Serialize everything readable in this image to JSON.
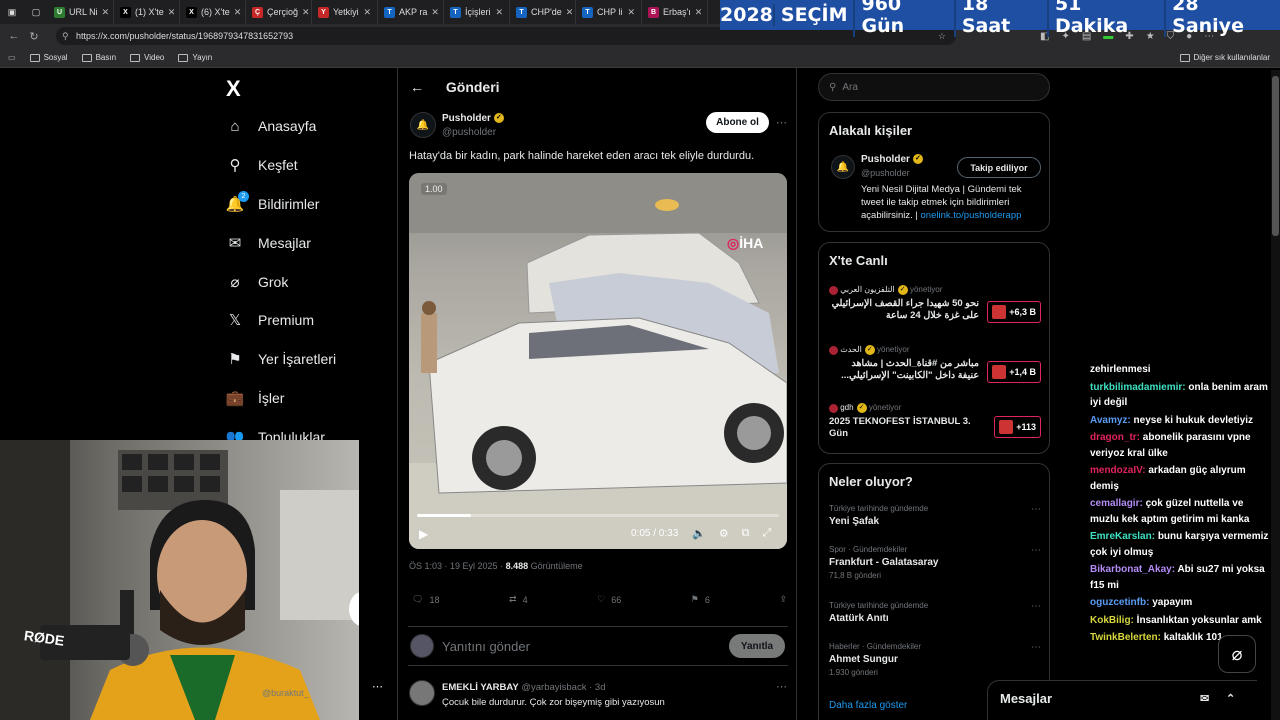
{
  "browser": {
    "tabs": [
      {
        "label": "URL Ni",
        "color": "#2e7d32",
        "glyph": "U"
      },
      {
        "label": "(1) X'te",
        "color": "#000000",
        "glyph": "X"
      },
      {
        "label": "(6) X'te",
        "color": "#000000",
        "glyph": "X"
      },
      {
        "label": "Çerçioğ",
        "color": "#c62828",
        "glyph": "Ç"
      },
      {
        "label": "Yetkiyi",
        "color": "#c62828",
        "glyph": "Y"
      },
      {
        "label": "AKP ra",
        "color": "#1565c0",
        "glyph": "T"
      },
      {
        "label": "İçişleri",
        "color": "#1565c0",
        "glyph": "T"
      },
      {
        "label": "CHP'de",
        "color": "#1565c0",
        "glyph": "T"
      },
      {
        "label": "CHP li",
        "color": "#1565c0",
        "glyph": "T"
      },
      {
        "label": "Erbaş'ı",
        "color": "#ad1457",
        "glyph": "B"
      }
    ],
    "url": "https://x.com/pusholder/status/1968979347831652793",
    "bookmarks": [
      "Sosyal",
      "Basın",
      "Video",
      "Yayın"
    ],
    "other_bookmarks": "Diğer sık kullanılanlar"
  },
  "countdown": {
    "year": "2028",
    "label": "SEÇİM",
    "days": "960 Gün",
    "hours": "18 Saat",
    "minutes": "51 Dakika",
    "seconds": "28 Saniye"
  },
  "nav": {
    "logo": "X",
    "items": [
      {
        "label": "Anasayfa",
        "icon": "home-icon"
      },
      {
        "label": "Keşfet",
        "icon": "search-icon"
      },
      {
        "label": "Bildirimler",
        "icon": "bell-icon",
        "badge": "2"
      },
      {
        "label": "Mesajlar",
        "icon": "mail-icon"
      },
      {
        "label": "Grok",
        "icon": "grok-icon"
      },
      {
        "label": "Premium",
        "icon": "x-icon"
      },
      {
        "label": "Yer İşaretleri",
        "icon": "bookmark-icon"
      },
      {
        "label": "İşler",
        "icon": "briefcase-icon"
      },
      {
        "label": "Topluluklar",
        "icon": "people-icon"
      }
    ],
    "account_handle": "@buraktut_"
  },
  "post": {
    "header": "Gönderi",
    "author_name": "Pusholder",
    "author_handle": "@pusholder",
    "subscribe_label": "Abone ol",
    "text": "Hatay'da bir kadın, park halinde hareket eden aracı tek eliyle durdurdu.",
    "video": {
      "speed": "1.00",
      "watermark": "İHA",
      "time": "0:05 / 0:33",
      "progress": 0.15
    },
    "meta_time": "ÖS 1:03 · 19 Eyl 2025 ·",
    "views": "8.488",
    "views_label": "Görüntüleme",
    "replies": "18",
    "reposts": "4",
    "likes": "66",
    "bookmarks": "6",
    "reply_placeholder": "Yanıtını gönder",
    "reply_button": "Yanıtla"
  },
  "reply_tweet": {
    "name": "EMEKLİ YARBAY",
    "handle": "@yarbayisback",
    "age": "· 3d",
    "text": "Çocuk bile durdurur. Çok zor bişeymiş gibi yazıyosun"
  },
  "sidebar": {
    "search_placeholder": "Ara",
    "related": {
      "title": "Alakalı kişiler",
      "name": "Pusholder",
      "handle": "@pusholder",
      "follow_label": "Takip ediliyor",
      "bio": "Yeni Nesil Dijital Medya | Gündemi tek tweet ile takip etmek için bildirimleri açabilirsiniz. |",
      "link": "onelink.to/pusholderapp"
    },
    "live": {
      "title": "X'te Canlı",
      "items": [
        {
          "host": "التلفزيون العربي",
          "role": "yönetiyor",
          "text": "نحو 50 شهيدا جراء القصف الإسرائيلي على غزة خلال 24 ساعة",
          "count": "+6,3 B"
        },
        {
          "host": "الحدث",
          "role": "yönetiyor",
          "text": "مباشر من #قناة_الحدث | مشاهد عنيفة داخل \"الكابينت\" الإسرائيلي...",
          "count": "+1,4 B"
        },
        {
          "host": "gdh",
          "role": "yönetiyor",
          "text": "2025 TEKNOFEST İSTANBUL 3. Gün",
          "count": "+113"
        }
      ]
    },
    "trends": {
      "title": "Neler oluyor?",
      "items": [
        {
          "category": "Türkiye tarihinde gündemde",
          "name": "Yeni Şafak",
          "count": ""
        },
        {
          "category": "Spor · Gündemdekiler",
          "name": "Frankfurt - Galatasaray",
          "count": "71,8 B gönderi"
        },
        {
          "category": "Türkiye tarihinde gündemde",
          "name": "Atatürk Anıtı",
          "count": ""
        },
        {
          "category": "Haberler · Gündemdekiler",
          "name": "Ahmet Sungur",
          "count": "1.930 gönderi"
        }
      ],
      "more": "Daha fazla göster"
    },
    "messages_dock": "Mesajlar"
  },
  "chat": [
    {
      "user": "",
      "color": "#ffffff",
      "text": "zehirlenmesi"
    },
    {
      "user": "turkbilimadamiemir:",
      "color": "#3ee0c2",
      "text": "onla benim aram iyi değil"
    },
    {
      "user": "Avamyz:",
      "color": "#5b9cf5",
      "text": "neyse ki hukuk devletiyiz"
    },
    {
      "user": "dragon_tr:",
      "color": "#e0245e",
      "text": "abonelik parasını vpne veriyoz kral ülke"
    },
    {
      "user": "mendozaIV:",
      "color": "#e0245e",
      "text": "arkadan güç alıyrum demiş"
    },
    {
      "user": "cemallagir:",
      "color": "#b38cf5",
      "text": "çok güzel nuttella ve muzlu kek aptım getirim mi kanka"
    },
    {
      "user": "EmreKarslan:",
      "color": "#3ee0c2",
      "text": "bunu karşıya vermemiz çok iyi olmuş"
    },
    {
      "user": "Bikarbonat_Akay:",
      "color": "#b38cf5",
      "text": "Abi su27 mi yoksa f15 mi"
    },
    {
      "user": "oguzcetinfb:",
      "color": "#5b9cf5",
      "text": "yapayım"
    },
    {
      "user": "KokBilig:",
      "color": "#d6d63c",
      "text": "İnsanlıktan yoksunlar amk"
    },
    {
      "user": "TwinkBelerten:",
      "color": "#d6d63c",
      "text": "kaltaklık 101"
    }
  ],
  "webcam": {
    "mic_brand": "RØDE"
  }
}
